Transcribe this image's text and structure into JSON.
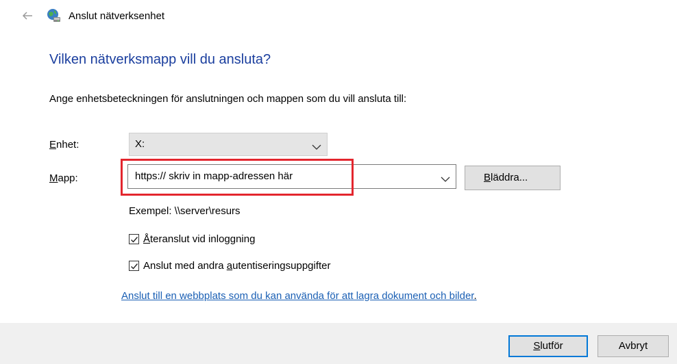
{
  "window": {
    "title": "Anslut nätverksenhet"
  },
  "heading": "Vilken nätverksmapp vill du ansluta?",
  "instruction": "Ange enhetsbeteckningen för anslutningen och mappen som du vill ansluta till:",
  "drive": {
    "label_access": "E",
    "label_rest": "nhet:",
    "value": "X:"
  },
  "folder": {
    "label_access": "M",
    "label_rest": "app:",
    "value": "https:// skriv in mapp-adressen här"
  },
  "browse_button": {
    "access": "B",
    "rest": "läddra..."
  },
  "example": "Exempel: \\\\server\\resurs",
  "reconnect": {
    "checked": true,
    "access": "Å",
    "rest": "teranslut vid inloggning"
  },
  "credentials": {
    "checked": true,
    "prefix": "Anslut med andra ",
    "access": "a",
    "rest": "utentiseringsuppgifter"
  },
  "link": {
    "text": "Anslut till en webbplats som du kan använda för att lagra dokument och bilder",
    "period": "."
  },
  "footer": {
    "finish": {
      "access": "S",
      "rest": "lutför"
    },
    "cancel": "Avbryt"
  },
  "colors": {
    "heading": "#1a3e9e",
    "link": "#1a5fb4",
    "highlight": "#e3262e",
    "focus": "#0078d7"
  }
}
